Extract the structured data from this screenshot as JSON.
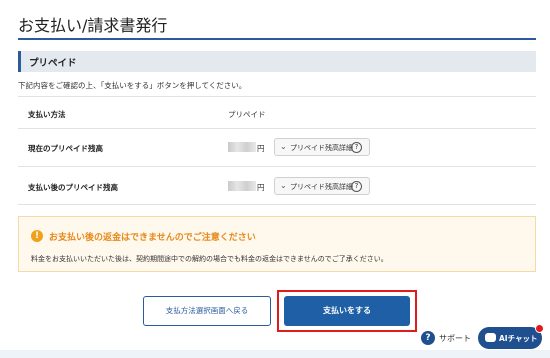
{
  "page": {
    "title": "お支払い/請求書発行"
  },
  "section": {
    "heading": "プリペイド"
  },
  "instruction": "下記内容をご確認の上、「支払いをする」ボタンを押してください。",
  "rows": [
    {
      "label": "支払い方法",
      "value": "プリペイド"
    },
    {
      "label": "現在のプリペイド残高",
      "unit": "円",
      "detail_label": "プリペイド残高詳細",
      "help": "?"
    },
    {
      "label": "支払い後のプリペイド残高",
      "unit": "円",
      "detail_label": "プリペイド残高詳細",
      "help": "?"
    }
  ],
  "notice": {
    "icon": "!",
    "title": "お支払い後の返金はできませんのでご注意ください",
    "body": "料金をお支払いいただいた後は、契約期間途中での解約の場合でも料金の返金はできませんのでご了承ください。"
  },
  "buttons": {
    "back": "支払方法選択画面へ戻る",
    "pay": "支払いをする"
  },
  "support": {
    "icon": "?",
    "label": "サポート"
  },
  "ai_chat": {
    "label": "AIチャット"
  },
  "colors": {
    "accent": "#2a5b9c",
    "pay": "#1f5fa6",
    "warning": "#e6891c",
    "highlight": "#e01b1b"
  }
}
